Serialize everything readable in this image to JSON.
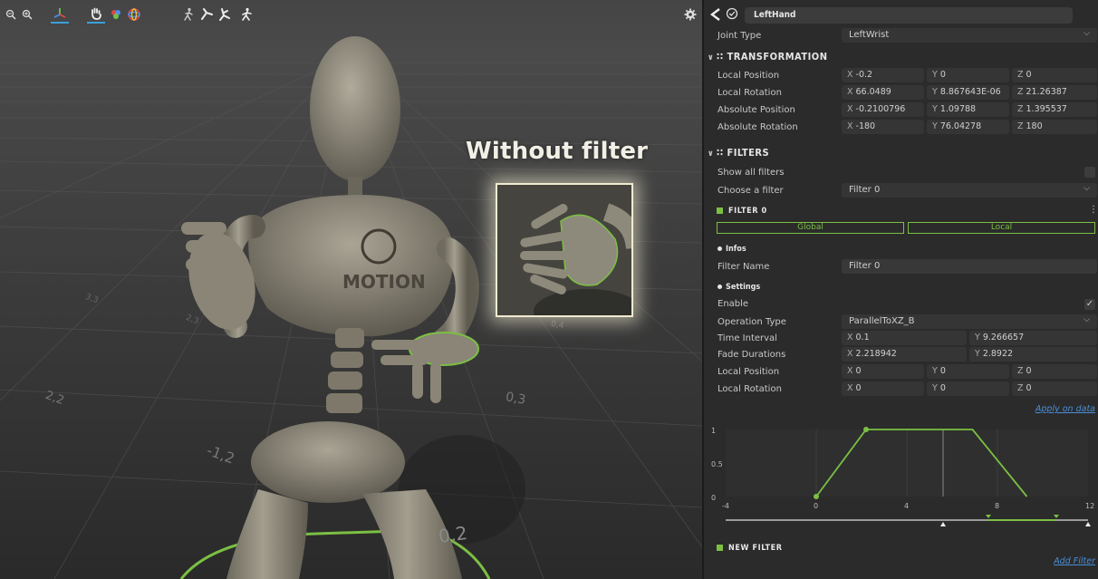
{
  "viewport": {
    "overlay_title": "Without filter",
    "toolbar": {
      "zoom_out": "zoom-out-icon",
      "zoom_in": "zoom-in-icon",
      "axis": "axis-gizmo-icon",
      "hand": "hand-pose-icon",
      "color_wheel": "color-wheel-icon",
      "figure_walk": "figure-walk-icon",
      "figure_arm": "figure-arm-icon",
      "figure_kneel": "figure-kneel-icon",
      "figure_run": "figure-run-icon",
      "settings": "gear-icon"
    },
    "grid_labels": [
      {
        "text": "2,2"
      },
      {
        "text": "-1,2"
      },
      {
        "text": "0,3"
      },
      {
        "text": "0,2"
      },
      {
        "text": "3,3"
      },
      {
        "text": "2,3"
      },
      {
        "text": "0,4"
      }
    ],
    "logo_text": "MOTION"
  },
  "inspector": {
    "object_name": "LeftHand",
    "joint_type": {
      "label": "Joint Type",
      "value": "LeftWrist"
    },
    "transformation": {
      "title": "TRANSFORMATION",
      "rows": [
        {
          "label": "Local Position",
          "x": "-0.2",
          "y": "0",
          "z": "0"
        },
        {
          "label": "Local Rotation",
          "x": "66.0489",
          "y": "8.867643E-06",
          "z": "21.26387"
        },
        {
          "label": "Absolute Position",
          "x": "-0.2100796",
          "y": "1.09788",
          "z": "1.395537"
        },
        {
          "label": "Absolute Rotation",
          "x": "-180",
          "y": "76.04278",
          "z": "180"
        }
      ]
    },
    "filters": {
      "title": "FILTERS",
      "show_all_label": "Show all filters",
      "choose_label": "Choose a filter",
      "choose_value": "Filter 0",
      "filter_title": "FILTER 0",
      "tab_global": "Global",
      "tab_local": "Local",
      "infos_title": "Infos",
      "filter_name_label": "Filter Name",
      "filter_name_value": "Filter 0",
      "settings_title": "Settings",
      "enable_label": "Enable",
      "enable_checked": true,
      "operation_type_label": "Operation Type",
      "operation_type_value": "ParallelToXZ_B",
      "time_interval_label": "Time Interval",
      "time_interval_x": "0.1",
      "time_interval_y": "9.266657",
      "fade_label": "Fade Durations",
      "fade_x": "2.218942",
      "fade_y": "2.8922",
      "local_position_label": "Local Position",
      "local_position": {
        "x": "0",
        "y": "0",
        "z": "0"
      },
      "local_rotation_label": "Local Rotation",
      "local_rotation": {
        "x": "0",
        "y": "0",
        "z": "0"
      },
      "apply_link": "Apply on data",
      "new_filter_title": "NEW FILTER",
      "add_link": "Add Filter",
      "axis_labels": {
        "x": "X",
        "y": "Y",
        "z": "Z"
      }
    },
    "curve": {
      "y_ticks": [
        "1",
        "0.5",
        "0"
      ],
      "x_ticks": [
        "-4",
        "0",
        "4",
        "8",
        "12"
      ],
      "points": [
        [
          0,
          0
        ],
        [
          2.2,
          1
        ],
        [
          6.9,
          1
        ],
        [
          9.3,
          0
        ]
      ],
      "cursor_x": 5.6,
      "x_range": [
        -4,
        12
      ],
      "accent": "#7bc043"
    }
  }
}
